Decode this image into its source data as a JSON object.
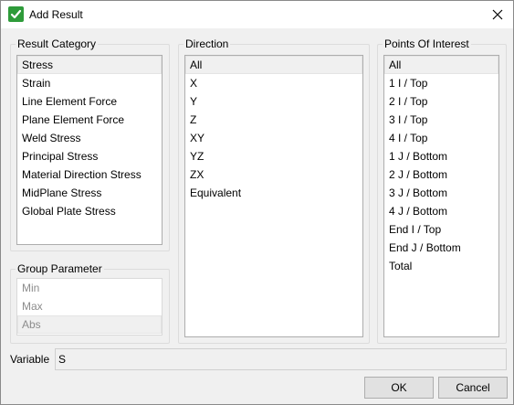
{
  "window": {
    "title": "Add Result"
  },
  "result_category": {
    "label": "Result Category",
    "items": [
      "Stress",
      "Strain",
      "Line Element Force",
      "Plane Element Force",
      "Weld Stress",
      "Principal Stress",
      "Material Direction Stress",
      "MidPlane Stress",
      "Global Plate Stress"
    ],
    "selected": "Stress"
  },
  "direction": {
    "label": "Direction",
    "items": [
      "All",
      "X",
      "Y",
      "Z",
      "XY",
      "YZ",
      "ZX",
      "Equivalent"
    ],
    "selected": "All"
  },
  "points_of_interest": {
    "label": "Points Of Interest",
    "items": [
      "All",
      "1 I / Top",
      "2 I / Top",
      "3 I / Top",
      "4 I / Top",
      "1 J / Bottom",
      "2 J / Bottom",
      "3 J / Bottom",
      "4 J / Bottom",
      "End I / Top",
      "End J / Bottom",
      "Total"
    ],
    "selected": "All"
  },
  "group_parameter": {
    "label": "Group Parameter",
    "items": [
      "Min",
      "Max",
      "Abs"
    ],
    "selected": "Abs"
  },
  "variable": {
    "label": "Variable",
    "value": "S"
  },
  "buttons": {
    "ok": "OK",
    "cancel": "Cancel"
  },
  "colors": {
    "accent": "#2e9b3a",
    "selection": "#f0f0f0"
  }
}
